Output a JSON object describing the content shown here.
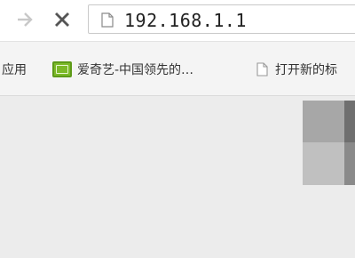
{
  "toolbar": {
    "forward_icon": "forward-arrow-icon",
    "stop_icon": "close-icon",
    "address": {
      "icon": "page-icon",
      "url": "192.168.1.1"
    }
  },
  "bookmarks": {
    "items": [
      {
        "label": "应用",
        "icon": ""
      },
      {
        "label": "爱奇艺-中国领先的…",
        "icon": "iqiyi-logo"
      },
      {
        "label": "打开新的标",
        "icon": "page-icon"
      }
    ]
  },
  "colors": {
    "toolbar_bg": "#ffffff",
    "bookmarks_bg": "#f4f4f4",
    "content_bg": "#ececec",
    "iqiyi_green": "#7cb928"
  }
}
